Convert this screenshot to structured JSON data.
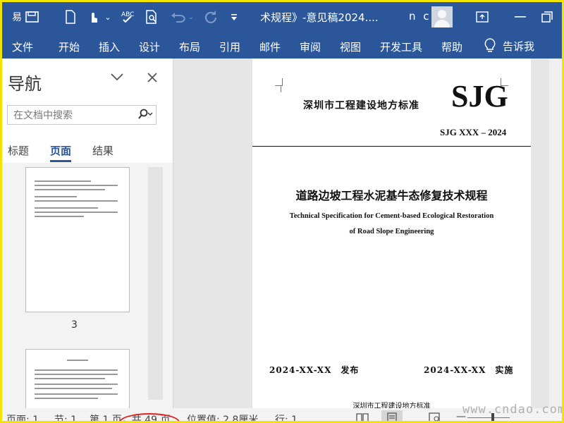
{
  "app": {
    "logo_text": "易",
    "title": "术规程》-意见稿2024....",
    "user_initials": "n c"
  },
  "qat": {
    "new_doc_icon": "new-document-icon",
    "touch_icon": "touch-mode-icon",
    "spelling_icon": "spelling-icon",
    "print_preview_icon": "print-preview-icon",
    "undo_icon": "undo-icon",
    "redo_icon": "redo-icon"
  },
  "ribbon": {
    "tabs": [
      "文件",
      "开始",
      "插入",
      "设计",
      "布局",
      "引用",
      "邮件",
      "审阅",
      "视图",
      "开发工具",
      "帮助"
    ],
    "tell_me": "告诉我"
  },
  "nav_pane": {
    "title": "导航",
    "search_placeholder": "在文档中搜索",
    "tabs": [
      "标题",
      "页面",
      "结果"
    ],
    "active_tab": "页面",
    "page_number": "3"
  },
  "document": {
    "org": "深圳市工程建设地方标准",
    "logo": "SJG",
    "code": "SJG XXX – 2024",
    "title_cn": "道路边坡工程水泥基牛态修复技术规程",
    "title_en_line1": "Technical Specification for Cement-based Ecological Restoration",
    "title_en_line2": "of Road Slope Engineering",
    "publish_date": "2024-XX-XX　发布",
    "implement_date": "2024-XX-XX　实施",
    "publisher": "深圳市工程建设地方标准"
  },
  "status_bar": {
    "page": "页面: 1",
    "section": "节: 1",
    "page_of": "第 1 页，共 49 页",
    "position": "位置值: 2.8厘米",
    "line": "行: 1"
  },
  "zoom": {
    "level_fraction": 0.6
  },
  "watermark": "www.cndao.com",
  "colors": {
    "accent": "#2b579a",
    "frame": "#f2e300",
    "annotation": "#e02020"
  }
}
